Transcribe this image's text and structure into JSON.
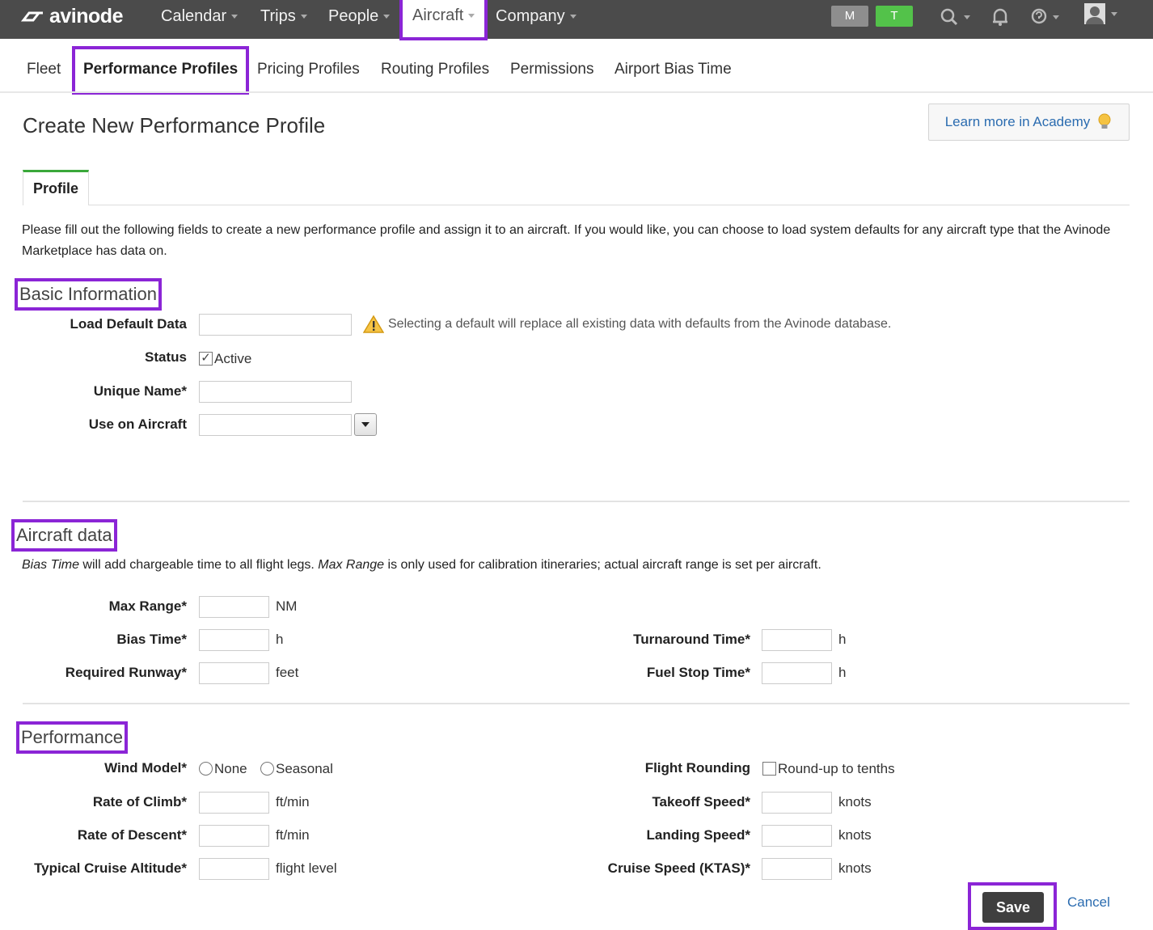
{
  "topnav": {
    "brand": "avinode",
    "items": [
      {
        "label": "Calendar"
      },
      {
        "label": "Trips"
      },
      {
        "label": "People"
      },
      {
        "label": "Aircraft"
      },
      {
        "label": "Company"
      }
    ],
    "badges": [
      {
        "label": "M",
        "color": "#8e8e8e"
      },
      {
        "label": "T",
        "color": "#53c24a"
      }
    ]
  },
  "subnav": {
    "tabs": [
      {
        "label": "Fleet"
      },
      {
        "label": "Performance Profiles"
      },
      {
        "label": "Pricing Profiles"
      },
      {
        "label": "Routing Profiles"
      },
      {
        "label": "Permissions"
      },
      {
        "label": "Airport Bias Time"
      }
    ]
  },
  "page": {
    "title": "Create New Performance Profile",
    "academy_label": "Learn more in Academy",
    "tab_label": "Profile",
    "intro": "Please fill out the following fields to create a new performance profile and assign it to an aircraft. If you would like, you can choose to load system defaults for any aircraft type that the Avinode Marketplace has data on."
  },
  "basic": {
    "heading": "Basic Information",
    "load_default_label": "Load Default Data",
    "load_default_value": "",
    "warning": "Selecting a default will replace all existing data with defaults from the Avinode database.",
    "status_label": "Status",
    "status_option": "Active",
    "status_checked": true,
    "unique_name_label": "Unique Name*",
    "unique_name_value": "",
    "use_on_aircraft_label": "Use on Aircraft",
    "use_on_aircraft_value": ""
  },
  "aircraft": {
    "heading": "Aircraft data",
    "note_term1": "Bias Time",
    "note_mid": " will add chargeable time to all flight legs. ",
    "note_term2": "Max Range",
    "note_end": " is only used for calibration itineraries; actual aircraft range is set per aircraft.",
    "max_range_label": "Max Range*",
    "max_range_unit": "NM",
    "bias_time_label": "Bias Time*",
    "bias_time_unit": "h",
    "runway_label": "Required Runway*",
    "runway_unit": "feet",
    "turnaround_label": "Turnaround Time*",
    "turnaround_unit": "h",
    "fuel_stop_label": "Fuel Stop Time*",
    "fuel_stop_unit": "h"
  },
  "performance": {
    "heading": "Performance",
    "wind_label": "Wind Model*",
    "wind_options": [
      "None",
      "Seasonal"
    ],
    "climb_label": "Rate of Climb*",
    "climb_unit": "ft/min",
    "descent_label": "Rate of Descent*",
    "descent_unit": "ft/min",
    "altitude_label": "Typical Cruise Altitude*",
    "altitude_unit": "flight level",
    "rounding_label": "Flight Rounding",
    "rounding_option": "Round-up to tenths",
    "takeoff_label": "Takeoff Speed*",
    "takeoff_unit": "knots",
    "landing_label": "Landing Speed*",
    "landing_unit": "knots",
    "cruise_label": "Cruise Speed (KTAS)*",
    "cruise_unit": "knots"
  },
  "actions": {
    "save_label": "Save",
    "cancel_label": "Cancel"
  }
}
